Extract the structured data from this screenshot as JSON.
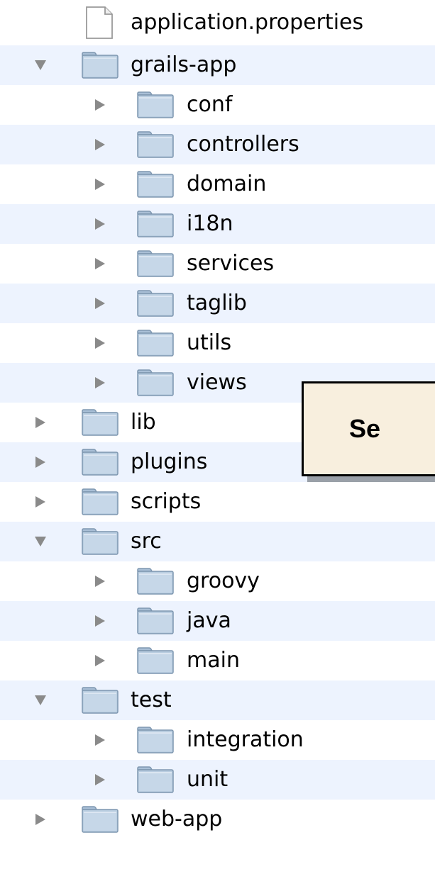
{
  "tree": {
    "items": [
      {
        "label": "application.properties",
        "depth": 0,
        "type": "file",
        "toggle": "none"
      },
      {
        "label": "grails-app",
        "depth": 0,
        "type": "folder",
        "toggle": "expanded"
      },
      {
        "label": "conf",
        "depth": 1,
        "type": "folder",
        "toggle": "collapsed"
      },
      {
        "label": "controllers",
        "depth": 1,
        "type": "folder",
        "toggle": "collapsed"
      },
      {
        "label": "domain",
        "depth": 1,
        "type": "folder",
        "toggle": "collapsed"
      },
      {
        "label": "i18n",
        "depth": 1,
        "type": "folder",
        "toggle": "collapsed"
      },
      {
        "label": "services",
        "depth": 1,
        "type": "folder",
        "toggle": "collapsed"
      },
      {
        "label": "taglib",
        "depth": 1,
        "type": "folder",
        "toggle": "collapsed"
      },
      {
        "label": "utils",
        "depth": 1,
        "type": "folder",
        "toggle": "collapsed"
      },
      {
        "label": "views",
        "depth": 1,
        "type": "folder",
        "toggle": "collapsed"
      },
      {
        "label": "lib",
        "depth": 0,
        "type": "folder",
        "toggle": "collapsed"
      },
      {
        "label": "plugins",
        "depth": 0,
        "type": "folder",
        "toggle": "collapsed"
      },
      {
        "label": "scripts",
        "depth": 0,
        "type": "folder",
        "toggle": "collapsed"
      },
      {
        "label": "src",
        "depth": 0,
        "type": "folder",
        "toggle": "expanded"
      },
      {
        "label": "groovy",
        "depth": 1,
        "type": "folder",
        "toggle": "collapsed"
      },
      {
        "label": "java",
        "depth": 1,
        "type": "folder",
        "toggle": "collapsed"
      },
      {
        "label": "main",
        "depth": 1,
        "type": "folder",
        "toggle": "collapsed"
      },
      {
        "label": "test",
        "depth": 0,
        "type": "folder",
        "toggle": "expanded"
      },
      {
        "label": "integration",
        "depth": 1,
        "type": "folder",
        "toggle": "collapsed"
      },
      {
        "label": "unit",
        "depth": 1,
        "type": "folder",
        "toggle": "collapsed"
      },
      {
        "label": "web-app",
        "depth": 0,
        "type": "folder",
        "toggle": "collapsed"
      }
    ]
  },
  "callout": {
    "text": "Se"
  },
  "colors": {
    "row_alt": "#edf3fe",
    "callout_fill": "#f8efde",
    "folder_fill": "#b9cde0",
    "folder_edge": "#7e97b0",
    "toggle": "#8a8a8a"
  }
}
